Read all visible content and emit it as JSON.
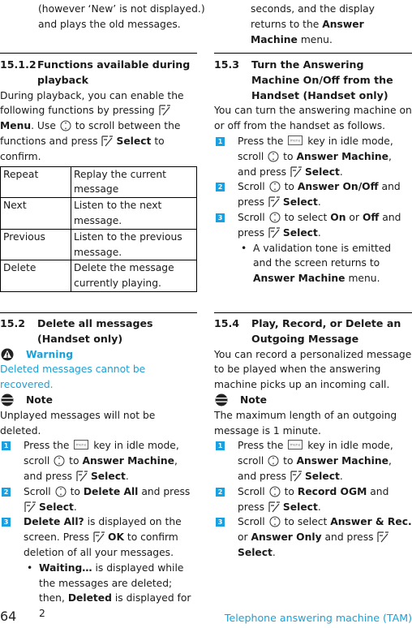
{
  "page": {
    "number": "64",
    "footer_title": "Telephone answering machine (TAM)",
    "accent_color": "#1aa0d8"
  },
  "left": {
    "top_continuation": [
      "(however ‘New’ is not displayed.)",
      "and plays the old messages."
    ],
    "s1512": {
      "number": "15.1.2",
      "title_line1": "Functions available during",
      "title_line2": "playback",
      "intro": {
        "t1": "During playback, you can enable the following functions by pressing",
        "menu": "Menu",
        "t2": ". Use",
        "t3": "to scroll between the functions and press",
        "select": "Select",
        "t4": "to confirm."
      },
      "table": [
        {
          "key": "Repeat",
          "desc": "Replay the current message"
        },
        {
          "key": "Next",
          "desc": "Listen to the next message."
        },
        {
          "key": "Previous",
          "desc": "Listen to the previous message."
        },
        {
          "key": "Delete",
          "desc": "Delete the message currently playing."
        }
      ]
    },
    "s152": {
      "number": "15.2",
      "title": "Delete all messages (Handset only)",
      "warning_label": "Warning",
      "warning_text": "Deleted messages cannot be recovered.",
      "note_label": "Note",
      "note_text": "Unplayed messages will not be deleted.",
      "steps": [
        {
          "n": "1",
          "a": "Press the",
          "b": "key in idle mode, scroll",
          "c": "to",
          "bold1": "Answer Machine",
          "d": ", and press",
          "bold2": "Select",
          "e": "."
        },
        {
          "n": "2",
          "a": "Scroll",
          "b": "to",
          "bold1": "Delete All",
          "c": "and press",
          "bold2": "Select",
          "d": "."
        },
        {
          "n": "3",
          "bold1": "Delete All?",
          "a": "is displayed on the screen. Press",
          "bold2": "OK",
          "b": "to confirm deletion of all your messages."
        }
      ],
      "bullet": {
        "bold1": "Waiting…",
        "a": "is displayed while the messages are deleted; then,",
        "bold2": "Deleted",
        "b": "is displayed for 2"
      }
    }
  },
  "right": {
    "top_continuation": {
      "a": "seconds, and the display returns to the",
      "bold": "Answer Machine",
      "b": "menu."
    },
    "s153": {
      "number": "15.3",
      "title": "Turn the Answering Machine On/Off from the Handset (Handset only)",
      "intro": "You can turn the answering machine on or off from the handset as follows.",
      "steps": [
        {
          "n": "1",
          "a": "Press the",
          "b": "key in idle mode, scroll",
          "c": "to",
          "bold1": "Answer Machine",
          "d": ", and press",
          "bold2": "Select",
          "e": "."
        },
        {
          "n": "2",
          "a": "Scroll",
          "b": "to",
          "bold1": "Answer On/Off",
          "c": "and press",
          "bold2": "Select",
          "d": "."
        },
        {
          "n": "3",
          "a": "Scroll",
          "b": "to select",
          "bold1": "On",
          "c": "or",
          "bold2": "Off",
          "d": "and press",
          "bold3": "Select",
          "e": "."
        }
      ],
      "bullet": {
        "a": "A validation tone is emitted and the screen returns to",
        "bold": "Answer Machine",
        "b": "menu."
      }
    },
    "s154": {
      "number": "15.4",
      "title": "Play, Record, or Delete an Outgoing Message",
      "intro": "You can record a personalized message to be played when the answering machine picks up an incoming call.",
      "note_label": "Note",
      "note_text": "The maximum length of an outgoing message is 1 minute.",
      "steps": [
        {
          "n": "1",
          "a": "Press the",
          "b": "key in idle mode, scroll",
          "c": "to",
          "bold1": "Answer Machine",
          "d": ", and press",
          "bold2": "Select",
          "e": "."
        },
        {
          "n": "2",
          "a": "Scroll",
          "b": "to",
          "bold1": "Record OGM",
          "c": "and press",
          "bold2": "Select",
          "d": "."
        },
        {
          "n": "3",
          "a": "Scroll",
          "b": "to select",
          "bold1": "Answer & Rec.",
          "c": "or",
          "bold2": "Answer Only",
          "d": "and press",
          "bold3": "Select",
          "e": "."
        }
      ]
    }
  }
}
